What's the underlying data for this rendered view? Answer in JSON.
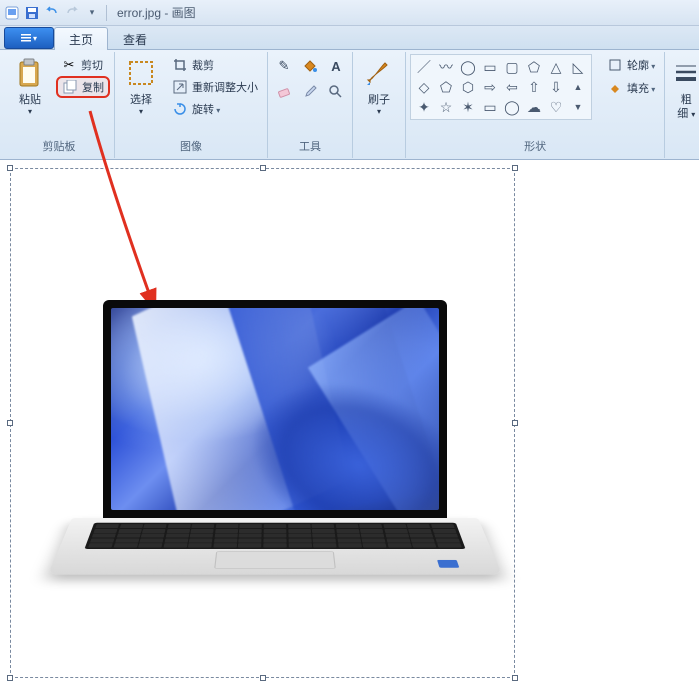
{
  "title": "error.jpg - 画图",
  "tabs": {
    "home": "主页",
    "view": "查看"
  },
  "ribbon": {
    "clipboard": {
      "label": "剪贴板",
      "paste": "粘贴",
      "cut": "剪切",
      "copy": "复制"
    },
    "image": {
      "label": "图像",
      "select": "选择",
      "crop": "裁剪",
      "resize": "重新调整大小",
      "rotate": "旋转"
    },
    "tools": {
      "label": "工具"
    },
    "brush": {
      "label": "刷子"
    },
    "shapes": {
      "label": "形状",
      "outline": "轮廓",
      "fill": "填充"
    },
    "thickness": {
      "label1": "粗",
      "label2": "细"
    }
  }
}
